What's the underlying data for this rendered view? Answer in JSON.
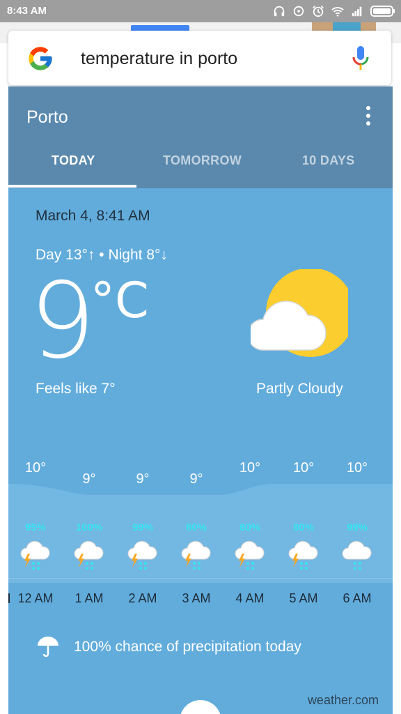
{
  "status_bar": {
    "time": "8:43 AM"
  },
  "search": {
    "query": "temperature in porto"
  },
  "weather": {
    "city": "Porto",
    "tabs": [
      {
        "label": "TODAY",
        "active": true
      },
      {
        "label": "TOMORROW",
        "active": false
      },
      {
        "label": "10 DAYS",
        "active": false
      }
    ],
    "datetime": "March 4, 8:41 AM",
    "day_night": "Day 13°↑ • Night 8°↓",
    "current_temp": "9",
    "unit": "°C",
    "feels_like": "Feels like 7°",
    "condition": "Partly Cloudy",
    "hourly": [
      {
        "temp": "10°",
        "precip": "95%",
        "time": "12 AM",
        "icon": "thunder-rain-icon"
      },
      {
        "temp": "9°",
        "precip": "100%",
        "time": "1 AM",
        "icon": "thunder-rain-icon"
      },
      {
        "temp": "9°",
        "precip": "99%",
        "time": "2 AM",
        "icon": "thunder-rain-icon"
      },
      {
        "temp": "9°",
        "precip": "80%",
        "time": "3 AM",
        "icon": "thunder-rain-icon"
      },
      {
        "temp": "10°",
        "precip": "80%",
        "time": "4 AM",
        "icon": "thunder-rain-icon"
      },
      {
        "temp": "10°",
        "precip": "80%",
        "time": "5 AM",
        "icon": "thunder-rain-icon"
      },
      {
        "temp": "10°",
        "precip": "98%",
        "time": "6 AM",
        "icon": "rain-icon"
      }
    ],
    "precip_summary": "100% chance of precipitation today",
    "source": "weather.com"
  },
  "colors": {
    "header": "#5a89ad",
    "card": "#62acdc",
    "precip_text": "#38e4f0",
    "sun": "#fbcd2e"
  }
}
